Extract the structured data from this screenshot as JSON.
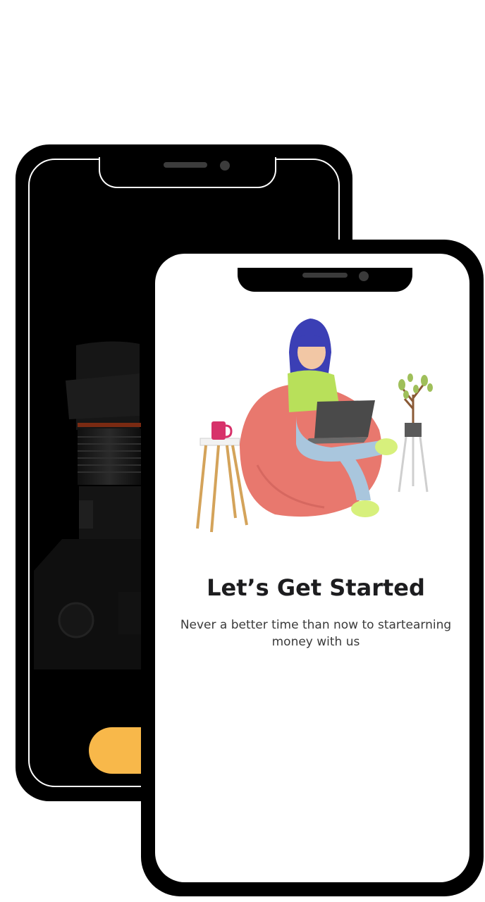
{
  "onboarding": {
    "title": "Let’s Get Started",
    "subtitle": "Never a better time than now to startearning money with us"
  },
  "colors": {
    "accent_yellow": "#f8b84a",
    "title_text": "#1d1d1f",
    "phone_body": "#000000"
  },
  "icons": {
    "back_phone_camera": "camera-illustration",
    "hero": "girl-laptop-beanbag-illustration"
  }
}
